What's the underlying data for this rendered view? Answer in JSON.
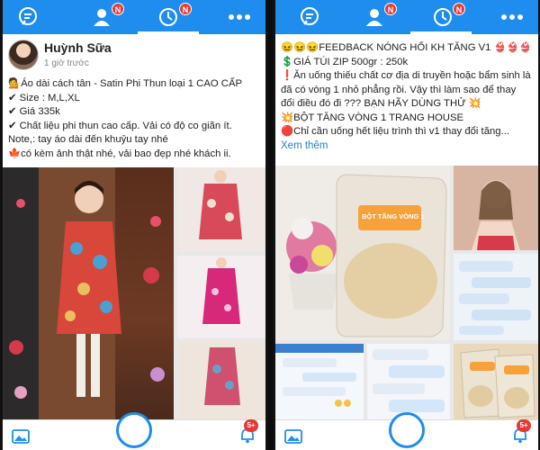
{
  "topbar": {
    "badge_contacts": "N",
    "badge_timeline": "N",
    "color_bar": "#1f8ded"
  },
  "left_post": {
    "author": "Huỳnh Sữa",
    "timestamp": "1 giờ trước",
    "lines": [
      "💁Áo dài cách tân - Satin Phi Thun loại 1 CAO CẤP",
      "✔ Size : M,L,XL",
      "✔ Giá 335k",
      "✔ Chất liệu phi thun cao cấp. Vải có độ co giãn ít.",
      "Note,: tay áo dài đến khuỷu tay nhé",
      "🍁có kèm ảnh thật nhé, vải bao đẹp nhé khách ii."
    ],
    "notif_badge": "5+"
  },
  "right_post": {
    "lines": [
      "😖😖😖FEEDBACK NÓNG HỔI KH TĂNG V1 👙👙👙",
      "💲GIÁ TÚI ZIP 500gr : 250k",
      "❗Ăn uống thiếu chất cơ địa di truyền hoặc bẩm sinh là",
      "đã có vòng 1 nhỏ phẳng rồi. Vậy thì làm sao để thay",
      "đổi điều đó đi ??? BẠN HÃY DÙNG THỬ 💥",
      "💥BỘT TĂNG VÒNG 1 TRANG HOUSE",
      "🔴Chỉ cần uống hết liệu trình thì v1 thay đổi tăng..."
    ],
    "see_more": "Xem thêm",
    "product_label": "BỘT TĂNG VÒNG 1",
    "notif_badge": "5+"
  }
}
